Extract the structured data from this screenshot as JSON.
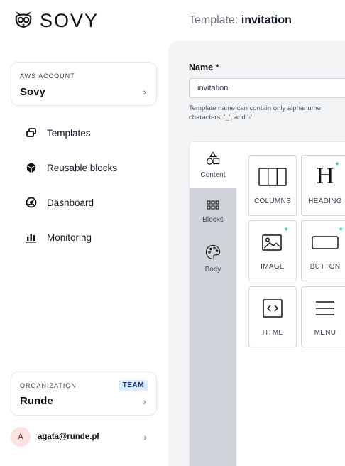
{
  "brand": {
    "name": "SOVY",
    "logo_icon": "owl-icon"
  },
  "header": {
    "prefix": "Template: ",
    "name": "invitation"
  },
  "sidebar": {
    "aws_account": {
      "label": "AWS ACCOUNT",
      "value": "Sovy"
    },
    "nav": [
      {
        "label": "Templates",
        "icon": "templates-icon"
      },
      {
        "label": "Reusable blocks",
        "icon": "cube-icon"
      },
      {
        "label": "Dashboard",
        "icon": "gauge-icon"
      },
      {
        "label": "Monitoring",
        "icon": "bar-chart-icon"
      }
    ],
    "organization": {
      "label": "ORGANIZATION",
      "badge": "TEAM",
      "value": "Runde"
    },
    "user": {
      "initial": "A",
      "email": "agata@runde.pl"
    }
  },
  "form": {
    "name_label": "Name *",
    "name_value": "invitation",
    "help_line1": "Template name can contain only alphanume",
    "help_line2": "characters, '_', and '-'."
  },
  "editor": {
    "tabs": [
      {
        "label": "Content",
        "icon": "shapes-icon",
        "active": true
      },
      {
        "label": "Blocks",
        "icon": "grid-icon",
        "active": false
      },
      {
        "label": "Body",
        "icon": "palette-icon",
        "active": false
      }
    ],
    "tiles": [
      {
        "label": "COLUMNS",
        "icon": "columns-icon"
      },
      {
        "label": "HEADING",
        "icon": "heading-icon"
      },
      {
        "label": "IMAGE",
        "icon": "image-icon"
      },
      {
        "label": "BUTTON",
        "icon": "button-icon"
      },
      {
        "label": "HTML",
        "icon": "code-icon"
      },
      {
        "label": "MENU",
        "icon": "menu-icon"
      }
    ]
  },
  "colors": {
    "accent_badge_bg": "#dbeafe",
    "sparkle": "#34d399",
    "panel_bg": "#f3f4f6"
  }
}
